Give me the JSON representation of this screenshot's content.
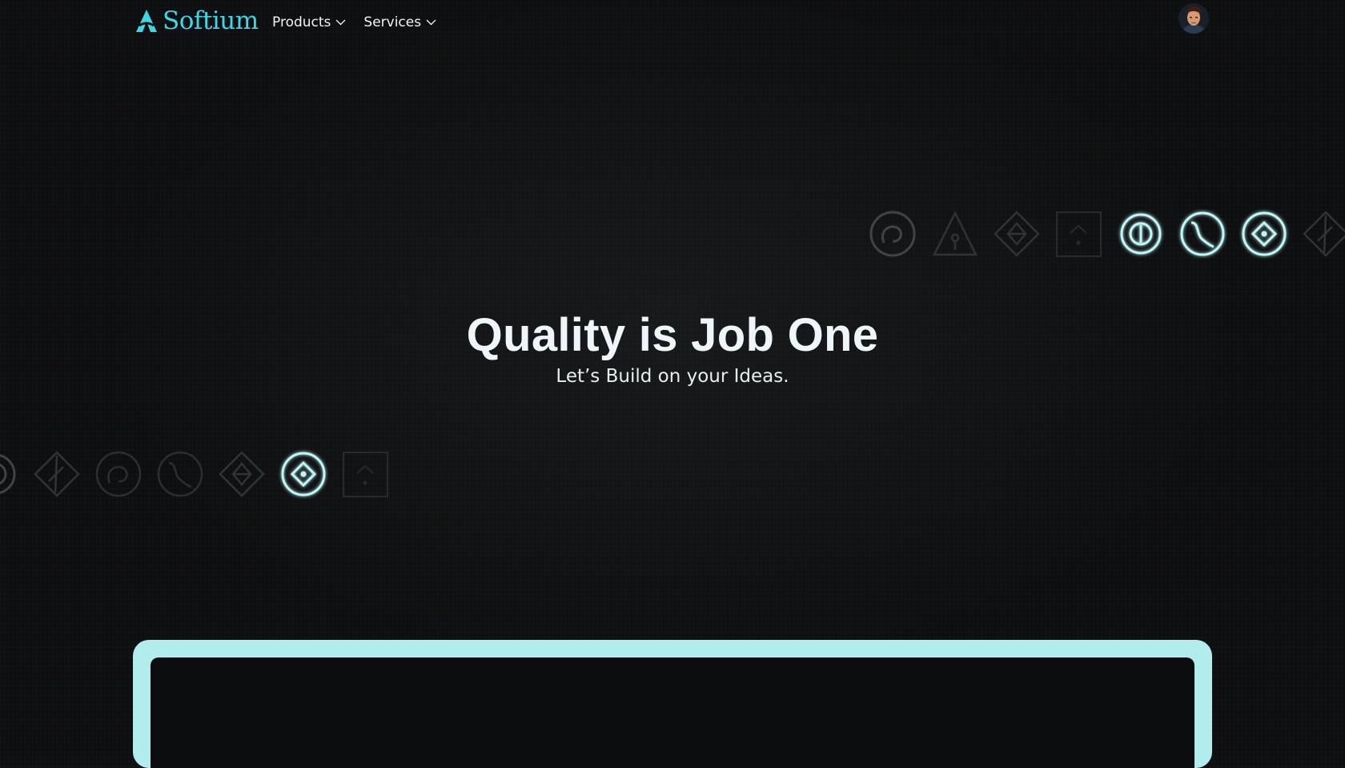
{
  "nav": {
    "brand_name": "Softium",
    "menu": [
      {
        "label": "Products",
        "icon": "chevron-down-icon"
      },
      {
        "label": "Services",
        "icon": "chevron-down-icon"
      }
    ],
    "avatar_icon": "user-avatar-icon"
  },
  "hero": {
    "title": "Quality is Job One",
    "subtitle": "Let’s Build on your Ideas."
  },
  "colors": {
    "accent": "#3fd6e6",
    "glow": "#bff6f7",
    "dim_icon": "#3e4546",
    "panel_border": "#b2ecec",
    "background": "#0d0e0f"
  },
  "glyph_rows": {
    "top": [
      "spiral-circle-icon",
      "triangle-person-icon",
      "diamond-split-icon",
      "square-caret-icon",
      "circle-bar-icon",
      "circle-wave-icon",
      "circle-diamond-icon",
      "diamond-slash-icon"
    ],
    "bottom": [
      "circle-bar-icon",
      "diamond-slash-icon",
      "spiral-circle-icon",
      "circle-wave-icon",
      "diamond-split-icon",
      "circle-diamond-icon",
      "square-caret-icon"
    ]
  }
}
